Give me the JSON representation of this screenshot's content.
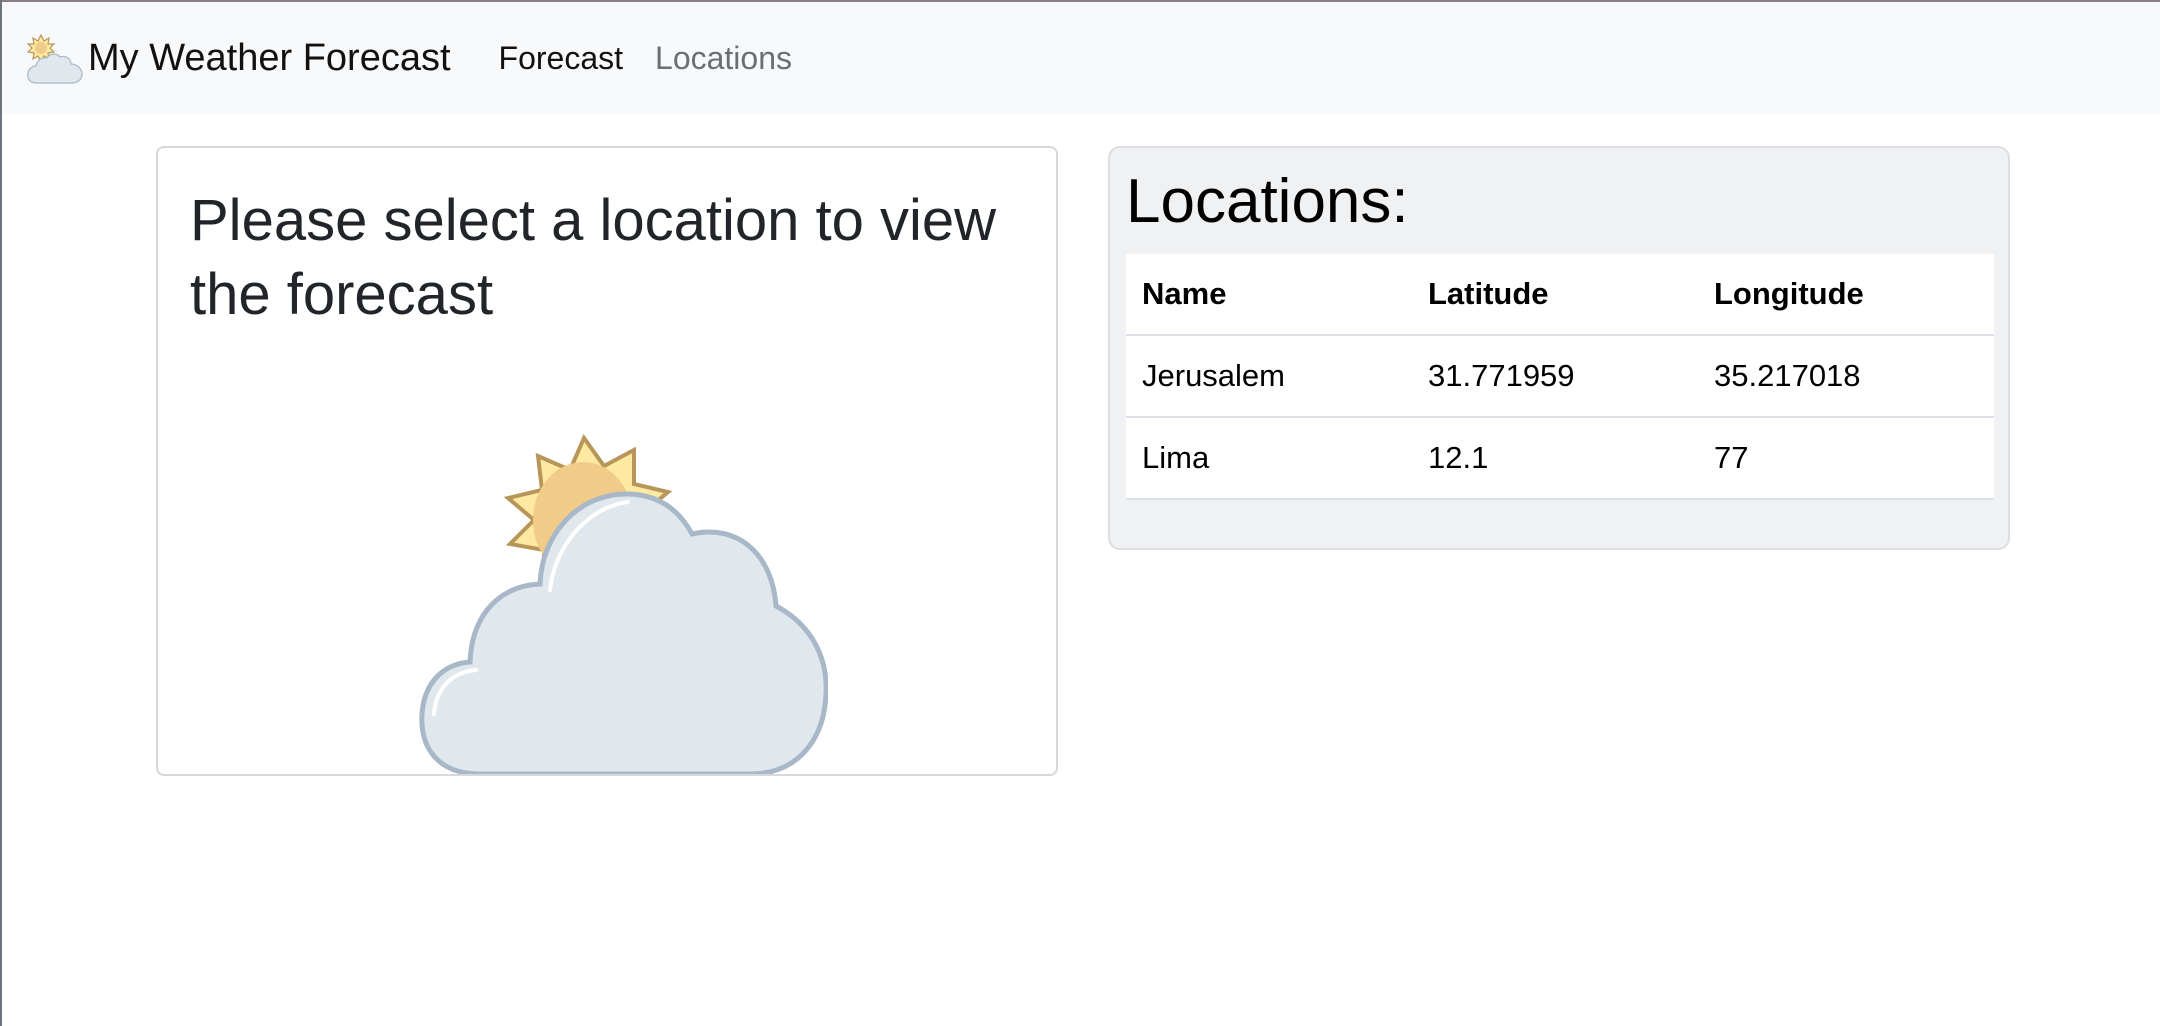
{
  "navbar": {
    "brand_title": "My Weather Forecast",
    "links": [
      {
        "label": "Forecast",
        "active": true
      },
      {
        "label": "Locations",
        "active": false
      }
    ]
  },
  "forecast_panel": {
    "title": "Please select a location to view the forecast",
    "illustration_icon": "partly-cloudy-icon"
  },
  "locations_panel": {
    "title": "Locations:",
    "columns": [
      "Name",
      "Latitude",
      "Longitude"
    ],
    "rows": [
      {
        "name": "Jerusalem",
        "latitude": "31.771959",
        "longitude": "35.217018"
      },
      {
        "name": "Lima",
        "latitude": "12.1",
        "longitude": "77"
      }
    ]
  },
  "colors": {
    "navbar_bg": "#f8f9fa",
    "panel_bg": "#f0f1f2",
    "sun_fill": "#fde9a0",
    "sun_stroke": "#b8965a",
    "cloud_fill": "#e0e8ee",
    "cloud_stroke": "#a8b8c8"
  }
}
